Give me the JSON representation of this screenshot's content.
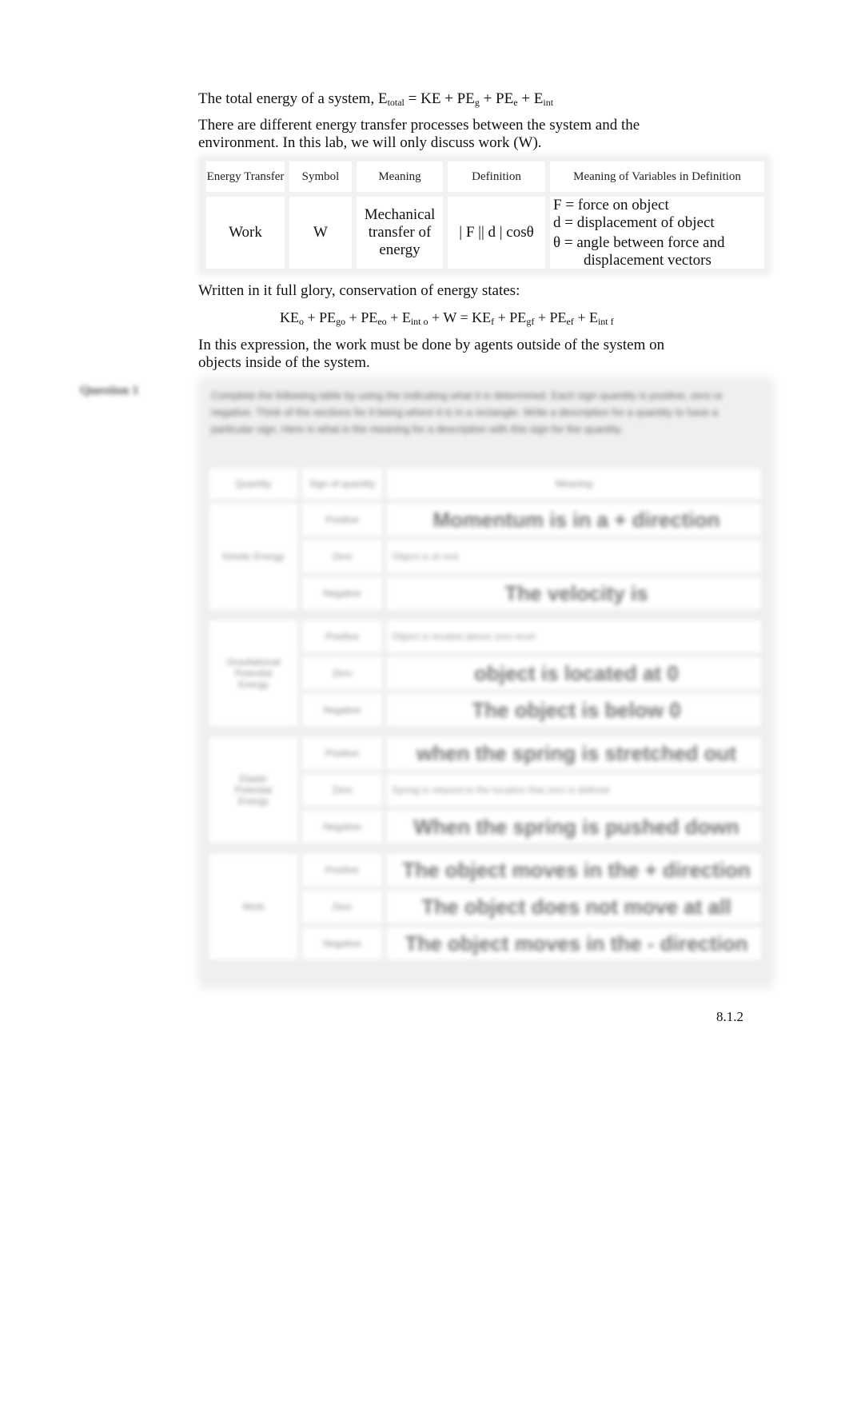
{
  "intro": {
    "total_energy_prefix": "The total energy of a system, E",
    "total_energy_sub": "total",
    "total_energy_terms": [
      {
        "base": " = KE + PE",
        "sub": "g"
      },
      {
        "base": " + PE",
        "sub": "e"
      },
      {
        "base": " + E",
        "sub": "int"
      }
    ],
    "transfer_line1": "There are different energy transfer processes between the system and the",
    "transfer_line2": "environment.  In this lab, we will only discuss work (W)."
  },
  "energy_table": {
    "headers": [
      "Energy Transfer",
      "Symbol",
      "Meaning",
      "Definition",
      "Meaning of Variables in Definition"
    ],
    "row": {
      "energy_transfer": "Work",
      "symbol": "W",
      "meaning": "Mechanical transfer of energy",
      "definition": "| F || d | cosθ",
      "variables": [
        "F = force on object",
        "d = displacement of object",
        "θ = angle between force and",
        "displacement vectors"
      ]
    }
  },
  "conservation": {
    "lead": "Written in it full glory, conservation of energy states:",
    "equation": [
      {
        "base": "KE",
        "sub": "o"
      },
      {
        "base": " + PE",
        "sub": "go"
      },
      {
        "base": " + PE",
        "sub": "eo"
      },
      {
        "base": " + E",
        "sub": "int o"
      },
      {
        "base": " + W = KE",
        "sub": "f"
      },
      {
        "base": " + PE",
        "sub": "gf"
      },
      {
        "base": " + PE",
        "sub": "ef"
      },
      {
        "base": " + E",
        "sub": "int f"
      }
    ],
    "note_line1": "In this expression, the work must be done by agents outside of the system on",
    "note_line2": "objects inside of the system."
  },
  "question": {
    "label": "Question 1",
    "instructions": "Complete the following table by using the indicating what it is determined. Each sign quantity is positive, zero or negative. Think of the sections for it being where it is in a rectangle. Write a description for a quantity to have a particular sign. Here is what is the meaning for a description with this sign for the quantity.",
    "headers": [
      "Quantity",
      "Sign of quantity",
      "Meaning"
    ],
    "groups": [
      {
        "quantity": "Kinetic Energy",
        "rows": [
          {
            "sign": "Positive",
            "meaning": "Momentum is in a + direction",
            "style": "big"
          },
          {
            "sign": "Zero",
            "meaning": "Object is at rest",
            "style": "small"
          },
          {
            "sign": "Negative",
            "meaning": "The velocity is",
            "style": "big"
          }
        ]
      },
      {
        "quantity": "Gravitational Potential Energy",
        "rows": [
          {
            "sign": "Positive",
            "meaning": "Object is located above zero level",
            "style": "small"
          },
          {
            "sign": "Zero",
            "meaning": "object is located at 0",
            "style": "big"
          },
          {
            "sign": "Negative",
            "meaning": "The object is below 0",
            "style": "big"
          }
        ]
      },
      {
        "quantity": "Elastic Potential Energy",
        "rows": [
          {
            "sign": "Positive",
            "meaning": "when the spring is stretched out",
            "style": "big"
          },
          {
            "sign": "Zero",
            "meaning": "Spring is relaxed to the location that zero is defined",
            "style": "small"
          },
          {
            "sign": "Negative",
            "meaning": "When the spring is pushed down",
            "style": "big"
          }
        ]
      },
      {
        "quantity": "Work",
        "rows": [
          {
            "sign": "Positive",
            "meaning": "The object moves in the + direction",
            "style": "big"
          },
          {
            "sign": "Zero",
            "meaning": "The object does not move at all",
            "style": "big"
          },
          {
            "sign": "Negative",
            "meaning": "The object moves in the - direction",
            "style": "big"
          }
        ]
      }
    ]
  },
  "page_number": "8.1.2"
}
